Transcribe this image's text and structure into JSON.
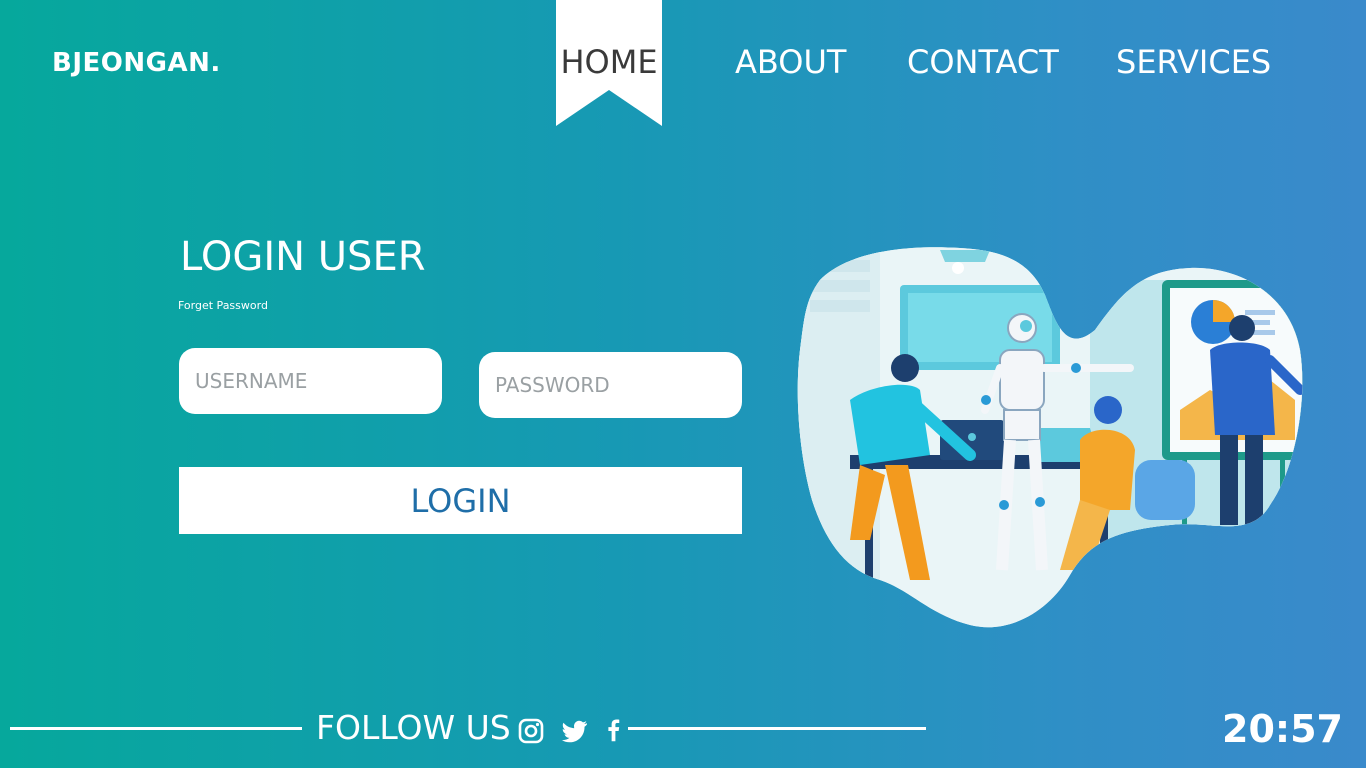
{
  "header": {
    "brand": "BJEONGAN.",
    "nav": [
      {
        "label": "HOME",
        "active": true
      },
      {
        "label": "ABOUT"
      },
      {
        "label": "CONTACT"
      },
      {
        "label": "SERVICES"
      }
    ]
  },
  "login": {
    "title": "LOGIN USER",
    "forget_password": "Forget Password",
    "username_placeholder": "USERNAME",
    "password_placeholder": "PASSWORD",
    "button_label": "LOGIN"
  },
  "footer": {
    "follow_label": "FOLLOW US",
    "social_icons": [
      "instagram-icon",
      "twitter-icon",
      "facebook-icon"
    ]
  },
  "clock": {
    "time": "20:57"
  },
  "colors": {
    "gradient_start": "#06a89c",
    "gradient_end": "#3a8acb",
    "login_button_text": "#1f6ea8",
    "active_nav_text": "#3a3a3a"
  }
}
